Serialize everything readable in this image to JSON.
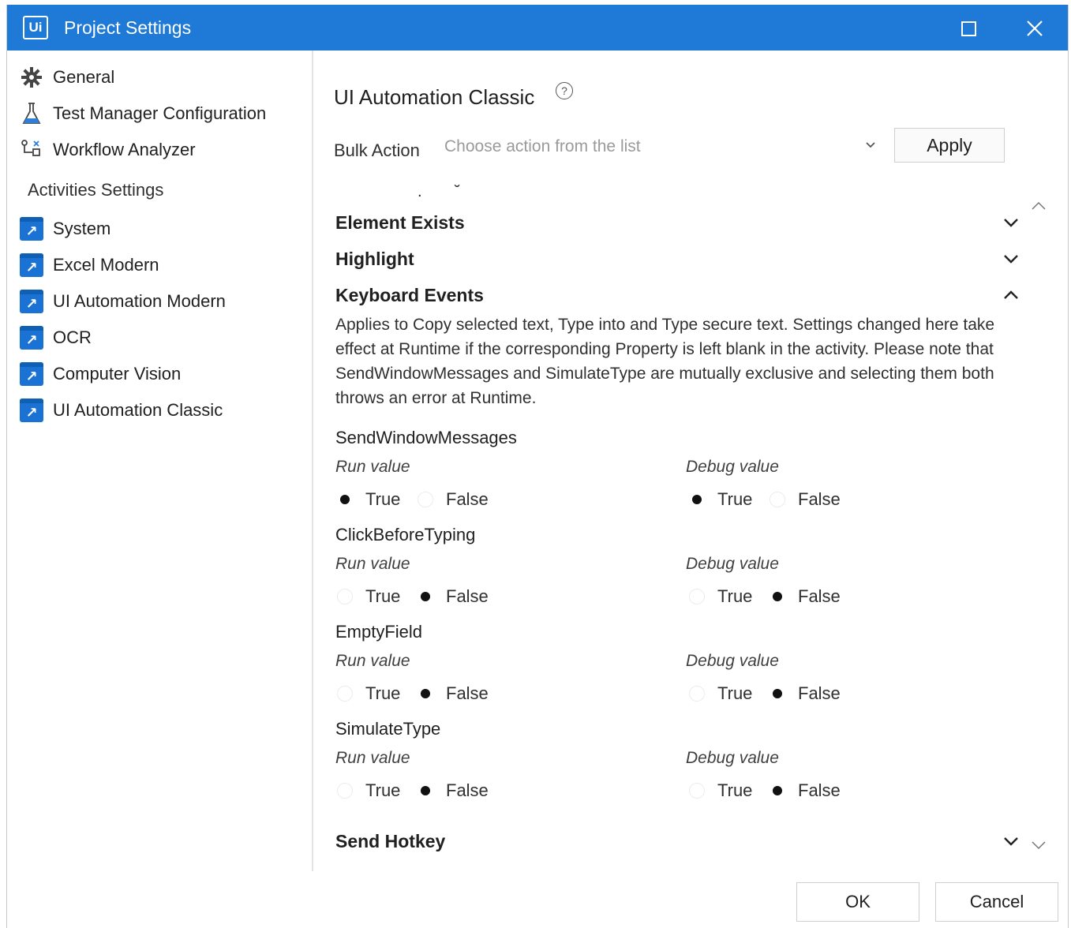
{
  "window": {
    "title": "Project Settings",
    "app_icon_text": "Ui",
    "title_bar_color": "#1e7ad6"
  },
  "sidebar": {
    "items": [
      {
        "label": "General",
        "icon": "gear-icon"
      },
      {
        "label": "Test Manager Configuration",
        "icon": "flask-icon"
      },
      {
        "label": "Workflow Analyzer",
        "icon": "workflow-icon"
      }
    ],
    "activities_heading": "Activities Settings",
    "activities": [
      {
        "label": "System",
        "icon": "activity-package-icon"
      },
      {
        "label": "Excel Modern",
        "icon": "activity-package-icon"
      },
      {
        "label": "UI Automation Modern",
        "icon": "activity-package-icon"
      },
      {
        "label": "OCR",
        "icon": "activity-package-icon"
      },
      {
        "label": "Computer Vision",
        "icon": "activity-package-icon"
      },
      {
        "label": "UI Automation Classic",
        "icon": "activity-package-icon"
      }
    ]
  },
  "main": {
    "title": "UI Automation Classic",
    "bulk_action": {
      "label": "Bulk Action",
      "placeholder": "Choose action from the list",
      "apply_label": "Apply"
    },
    "sections": [
      {
        "title": "Element Exists",
        "expanded": false
      },
      {
        "title": "Highlight",
        "expanded": false
      },
      {
        "title": "Keyboard Events",
        "expanded": true
      },
      {
        "title": "Send Hotkey",
        "expanded": false
      }
    ],
    "keyboard_events": {
      "description": "Applies to Copy selected text, Type into and Type secure text. Settings changed here take effect at Runtime if the corresponding Property is left blank in the activity. Please note that SendWindowMessages and SimulateType are mutually exclusive and selecting them both throws an error at Runtime.",
      "run_label": "Run value",
      "debug_label": "Debug value",
      "true_label": "True",
      "false_label": "False",
      "properties": [
        {
          "name": "SendWindowMessages",
          "run": true,
          "debug": true
        },
        {
          "name": "ClickBeforeTyping",
          "run": false,
          "debug": false
        },
        {
          "name": "EmptyField",
          "run": false,
          "debug": false
        },
        {
          "name": "SimulateType",
          "run": false,
          "debug": false
        }
      ]
    }
  },
  "footer": {
    "ok_label": "OK",
    "cancel_label": "Cancel"
  }
}
